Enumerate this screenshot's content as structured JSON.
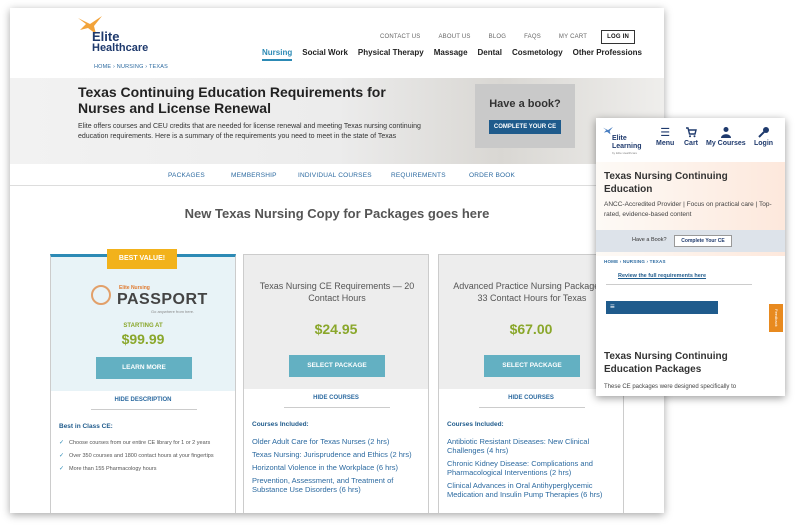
{
  "desktop": {
    "logo": {
      "line1": "Elite",
      "line2": "Healthcare"
    },
    "util_nav": [
      "CONTACT US",
      "ABOUT US",
      "BLOG",
      "FAQS",
      "MY CART"
    ],
    "login_label": "LOG IN",
    "main_nav": [
      "Nursing",
      "Social Work",
      "Physical Therapy",
      "Massage",
      "Dental",
      "Cosmetology",
      "Other Professions"
    ],
    "breadcrumb": "HOME › NURSING › TEXAS",
    "hero": {
      "title": "Texas Continuing Education Requirements for Nurses and License Renewal",
      "body": "Elite offers courses and CEU credits that are needed for license renewal and meeting Texas nursing continuing education requirements. Here is a summary of the requirements you need to meet in the state of Texas",
      "book_question": "Have a book?",
      "book_button": "COMPLETE YOUR CE"
    },
    "sub_nav": [
      "PACKAGES",
      "MEMBERSHIP",
      "INDIVIDUAL COURSES",
      "REQUIREMENTS",
      "ORDER BOOK"
    ],
    "section_title": "New Texas Nursing Copy for Packages goes here",
    "cards": [
      {
        "ribbon": "BEST VALUE!",
        "brand_small": "Elite Nursing",
        "brand_big": "PASSPORT",
        "brand_tag": "Go anywhere from here.",
        "starting": "STARTING AT",
        "price": "$99.99",
        "button": "LEARN MORE",
        "toggle": "HIDE DESCRIPTION",
        "heading": "Best in Class CE:",
        "items": [
          "Choose courses from our entire CE library for 1 or 2 years",
          "Over 350 courses and 1800 contact hours at your fingertips",
          "More than 155 Pharmacology hours"
        ]
      },
      {
        "title": "Texas Nursing CE Requirements — 20 Contact Hours",
        "price": "$24.95",
        "button": "SELECT PACKAGE",
        "toggle": "HIDE COURSES",
        "heading": "Courses Included:",
        "items": [
          "Older Adult Care for Texas Nurses (2 hrs)",
          "Texas Nursing: Jurisprudence and Ethics (2 hrs)",
          "Horizontal Violence in the Workplace (6 hrs)",
          "Prevention, Assessment, and Treatment of Substance Use Disorders (6 hrs)"
        ]
      },
      {
        "title": "Advanced Practice Nursing Package — 33 Contact Hours for Texas",
        "price": "$67.00",
        "button": "SELECT PACKAGE",
        "toggle": "HIDE COURSES",
        "heading": "Courses Included:",
        "items": [
          "Antibiotic Resistant Diseases: New Clinical Challenges (4 hrs)",
          "Chronic Kidney Disease: Complications and Pharmacological Interventions (2 hrs)",
          "Clinical Advances in Oral Antihyperglycemic Medication and Insulin Pump Therapies (6 hrs)"
        ]
      }
    ]
  },
  "mobile": {
    "logo": {
      "line1": "Elite",
      "line2": "Learning",
      "line3": "by Elite Healthcare"
    },
    "nav": [
      {
        "icon": "menu-icon",
        "label": "Menu"
      },
      {
        "icon": "cart-icon",
        "label": "Cart"
      },
      {
        "icon": "user-icon",
        "label": "My Courses"
      },
      {
        "icon": "key-icon",
        "label": "Login"
      }
    ],
    "title": "Texas Nursing Continuing Education",
    "subtitle": "ANCC-Accredited Provider | Focus on practical care | Top-rated, evidence-based content",
    "book_question": "Have a Book?",
    "book_button": "Complete Your CE",
    "breadcrumb": "HOME  ›  NURSING  ›  TEXAS",
    "review_link": "Review the full requirements here",
    "menu_glyph": "≡",
    "feedback": "Feedback",
    "packages_title": "Texas Nursing Continuing Education Packages",
    "packages_text": "These CE packages were designed specifically to"
  },
  "colors": {
    "brand_blue": "#1f5b8c",
    "accent_teal": "#63b0c2",
    "price_green": "#8aa72b",
    "ribbon_gold": "#f2b21b",
    "link_blue": "#2c6aa0"
  }
}
